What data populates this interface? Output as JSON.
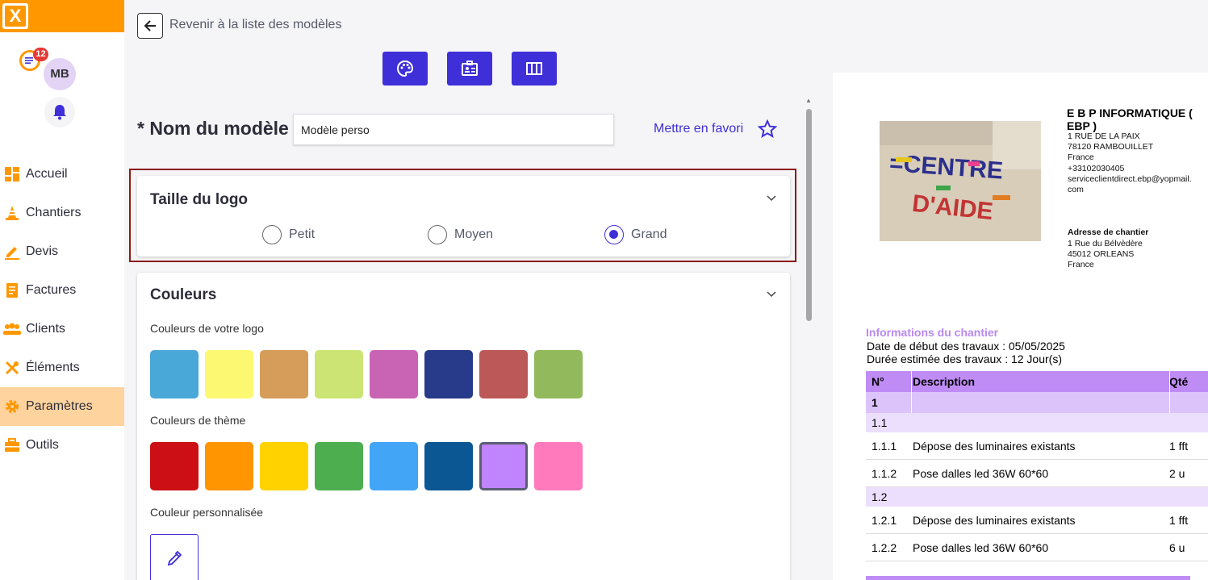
{
  "sidebar": {
    "brand_letter": "X",
    "notification_count": "12",
    "avatar_initials": "MB",
    "items": [
      {
        "label": "Accueil"
      },
      {
        "label": "Chantiers"
      },
      {
        "label": "Devis"
      },
      {
        "label": "Factures"
      },
      {
        "label": "Clients"
      },
      {
        "label": "Éléments"
      },
      {
        "label": "Paramètres"
      },
      {
        "label": "Outils"
      }
    ],
    "active_item": "Paramètres",
    "accent_color": "#ff9800"
  },
  "header": {
    "back_label": "Revenir à la liste des modèles",
    "toolbar_icons": [
      "palette-icon",
      "id-card-icon",
      "columns-icon"
    ]
  },
  "model": {
    "name_label": "* Nom du modèle",
    "name_value": "Modèle perso",
    "favorite_label": "Mettre en favori"
  },
  "logo_size": {
    "title": "Taille du logo",
    "options": [
      "Petit",
      "Moyen",
      "Grand"
    ],
    "selected": "Grand"
  },
  "colors": {
    "title": "Couleurs",
    "logo_colors_label": "Couleurs de votre logo",
    "logo_colors": [
      "#4aa8d8",
      "#fcf871",
      "#d69c5a",
      "#cbe474",
      "#c964b4",
      "#283a8a",
      "#bc5857",
      "#92ba5d"
    ],
    "theme_colors_label": "Couleurs de thème",
    "theme_colors": [
      "#cc0f14",
      "#ff9500",
      "#ffd200",
      "#4cae4f",
      "#42a5f5",
      "#0b5794",
      "#c084fc",
      "#ff79bd"
    ],
    "selected_theme_color": "#c084fc",
    "custom_color_label": "Couleur personnalisée"
  },
  "preview": {
    "company_name": "E B P INFORMATIQUE ( EBP )",
    "company_lines": [
      "1 RUE DE LA PAIX",
      "78120 RAMBOUILLET",
      "France",
      "+33102030405",
      "serviceclientdirect.ebp@yopmail.",
      "com"
    ],
    "site_address_title": "Adresse de chantier",
    "site_address_lines": [
      "1 Rue du Bélvèdère",
      "45012 ORLEANS",
      "France"
    ],
    "logo_text": "CENTRE D'AIDE",
    "info_title": "Informations du chantier",
    "info_lines": [
      "Date de début des travaux : 05/05/2025",
      "Durée estimée des travaux : 12 Jour(s)"
    ],
    "table": {
      "headers": [
        "N°",
        "Description",
        "Qté"
      ],
      "rows": [
        {
          "no": "1",
          "desc": "",
          "qty": "",
          "level": "l1"
        },
        {
          "no": "1.1",
          "desc": "",
          "qty": "",
          "level": "l2"
        },
        {
          "no": "1.1.1",
          "desc": "Dépose des luminaires existants",
          "qty": "1 fft",
          "level": "it"
        },
        {
          "no": "1.1.2",
          "desc": "Pose dalles led 36W 60*60",
          "qty": "2 u",
          "level": "it"
        },
        {
          "no": "1.2",
          "desc": "",
          "qty": "",
          "level": "l2"
        },
        {
          "no": "1.2.1",
          "desc": "Dépose des luminaires existants",
          "qty": "1 fft",
          "level": "it"
        },
        {
          "no": "1.2.2",
          "desc": "Pose dalles led 36W 60*60",
          "qty": "6 u",
          "level": "it"
        }
      ]
    }
  },
  "primary_color": "#3f2fd8"
}
